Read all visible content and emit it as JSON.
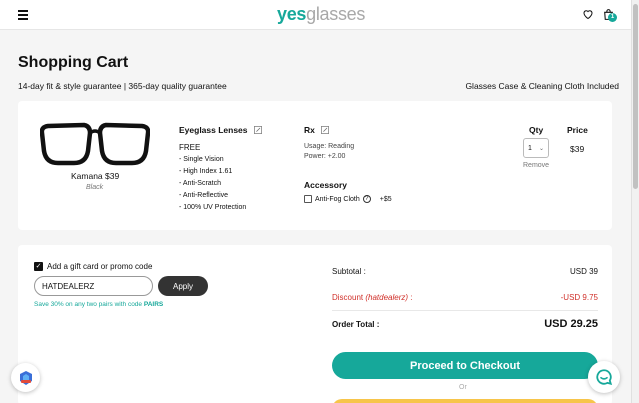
{
  "header": {
    "logo_part1": "yes",
    "logo_part2": "glasses",
    "cart_count": "1",
    "icons": [
      "menu-icon",
      "heart-icon",
      "shopping-bag-icon"
    ]
  },
  "page": {
    "title": "Shopping Cart",
    "guarantee": "14-day fit & style guarantee | 365-day quality guarantee",
    "included": "Glasses Case & Cleaning Cloth Included"
  },
  "item": {
    "frame_name": "Kamana $39",
    "frame_color": "Black",
    "lenses_heading": "Eyeglass Lenses",
    "lens_price": "FREE",
    "lens_features": [
      "- Single Vision",
      "- High Index 1.61",
      "- Anti-Scratch",
      "- Anti-Reflective",
      "- 100% UV Protection"
    ],
    "rx_heading": "Rx",
    "rx_usage": "Usage: Reading",
    "rx_power": "Power: +2.00",
    "accessory_heading": "Accessory",
    "accessory_label": "Anti-Fog Cloth",
    "accessory_price": "+$5",
    "qty_heading": "Qty",
    "price_heading": "Price",
    "qty_value": "1",
    "remove_label": "Remove",
    "price": "$39"
  },
  "promo": {
    "checkbox_label": "Add a gift card or promo code",
    "code_value": "HATDEALERZ",
    "apply_label": "Apply",
    "note_text": "Save 30% on any two pairs with code ",
    "note_code": "PAIRS"
  },
  "summary": {
    "subtotal_label": "Subtotal :",
    "subtotal_value": "USD 39",
    "discount_label": "Discount ",
    "discount_code": "(hatdealerz)",
    "discount_colon": " :",
    "discount_value": "-USD 9.75",
    "total_label": "Order Total :",
    "total_value": "USD 29.25",
    "checkout_label": "Proceed to Checkout",
    "or_label": "Or"
  },
  "colors": {
    "brand_teal": "#16a89a",
    "discount_red": "#d0302a",
    "paypal_yellow": "#f7c54a"
  }
}
